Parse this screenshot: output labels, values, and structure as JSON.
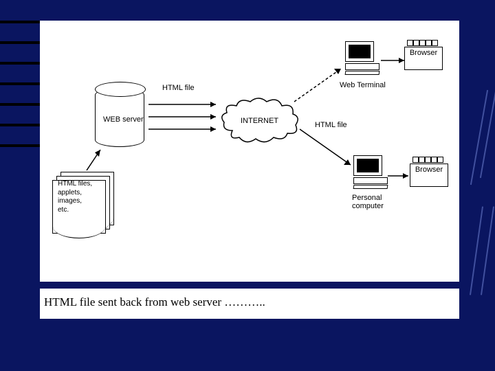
{
  "diagram": {
    "server_label": "WEB server",
    "files_label": "HTML files,\napplets,\nimages,\netc.",
    "cloud_label": "INTERNET",
    "html_file_label_top": "HTML file",
    "html_file_label_right": "HTML file",
    "terminal_label": "Web Terminal",
    "pc_label": "Personal\ncomputer",
    "browser1_label": "Browser",
    "browser2_label": "Browser"
  },
  "caption": "HTML file sent back from web server  ……….."
}
